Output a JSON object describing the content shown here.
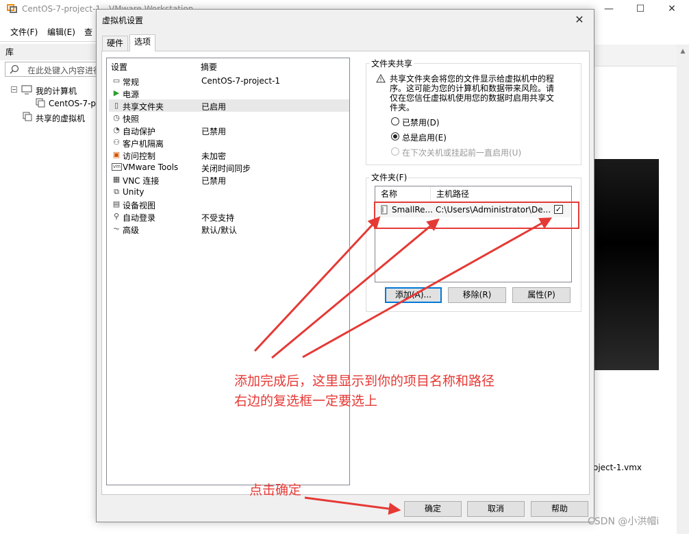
{
  "app": {
    "title": "CentOS-7-project-1 - VMware Workstation",
    "menus": [
      "文件(F)",
      "编辑(E)",
      "查"
    ],
    "library_label": "库",
    "search_placeholder": "在此处键入内容进行",
    "tree": [
      {
        "label": "我的计算机"
      },
      {
        "label": "CentOS-7-p"
      },
      {
        "label": "共享的虚拟机"
      }
    ],
    "vmx_text": "oject-1.vmx"
  },
  "dialog": {
    "title": "虚拟机设置",
    "tabs": [
      "硬件",
      "选项"
    ],
    "active_tab": "选项",
    "settings_headers": {
      "name": "设置",
      "summary": "摘要"
    },
    "settings": [
      {
        "icon": "general-icon",
        "name": "常规",
        "summary": "CentOS-7-project-1"
      },
      {
        "icon": "power-icon",
        "name": "电源",
        "summary": ""
      },
      {
        "icon": "shared-folder-icon",
        "name": "共享文件夹",
        "summary": "已启用"
      },
      {
        "icon": "snapshot-icon",
        "name": "快照",
        "summary": ""
      },
      {
        "icon": "autoprotect-icon",
        "name": "自动保护",
        "summary": "已禁用"
      },
      {
        "icon": "guest-isolation-icon",
        "name": "客户机隔离",
        "summary": ""
      },
      {
        "icon": "access-control-icon",
        "name": "访问控制",
        "summary": "未加密"
      },
      {
        "icon": "vmware-tools-icon",
        "name": "VMware Tools",
        "summary": "关闭时间同步"
      },
      {
        "icon": "vnc-icon",
        "name": "VNC 连接",
        "summary": "已禁用"
      },
      {
        "icon": "unity-icon",
        "name": "Unity",
        "summary": ""
      },
      {
        "icon": "appliance-view-icon",
        "name": "设备视图",
        "summary": ""
      },
      {
        "icon": "autologin-icon",
        "name": "自动登录",
        "summary": "不受支持"
      },
      {
        "icon": "advanced-icon",
        "name": "高级",
        "summary": "默认/默认"
      }
    ],
    "selected_setting": "共享文件夹",
    "sharing": {
      "group_label": "文件夹共享",
      "warning": "共享文件夹会将您的文件显示给虚拟机中的程序。这可能为您的计算机和数据带来风险。请仅在您信任虚拟机使用您的数据时启用共享文件夹。",
      "options": [
        {
          "label": "已禁用(D)",
          "checked": false,
          "enabled": true
        },
        {
          "label": "总是启用(E)",
          "checked": true,
          "enabled": true
        },
        {
          "label": "在下次关机或挂起前一直启用(U)",
          "checked": false,
          "enabled": false
        }
      ]
    },
    "folders": {
      "group_label": "文件夹(F)",
      "columns": [
        "名称",
        "主机路径"
      ],
      "rows": [
        {
          "name": "SmallRe...",
          "path": "C:\\Users\\Administrator\\De...",
          "enabled": true
        }
      ],
      "buttons": {
        "add": "添加(A)...",
        "remove": "移除(R)",
        "properties": "属性(P)"
      }
    },
    "footer": {
      "ok": "确定",
      "cancel": "取消",
      "help": "帮助"
    }
  },
  "annotations": {
    "note_line1": "添加完成后，这里显示到你的项目名称和路径",
    "note_line2": "右边的复选框一定要选上",
    "click_ok": "点击确定",
    "color": "#e53935"
  },
  "watermark": "CSDN @小洪帽i"
}
